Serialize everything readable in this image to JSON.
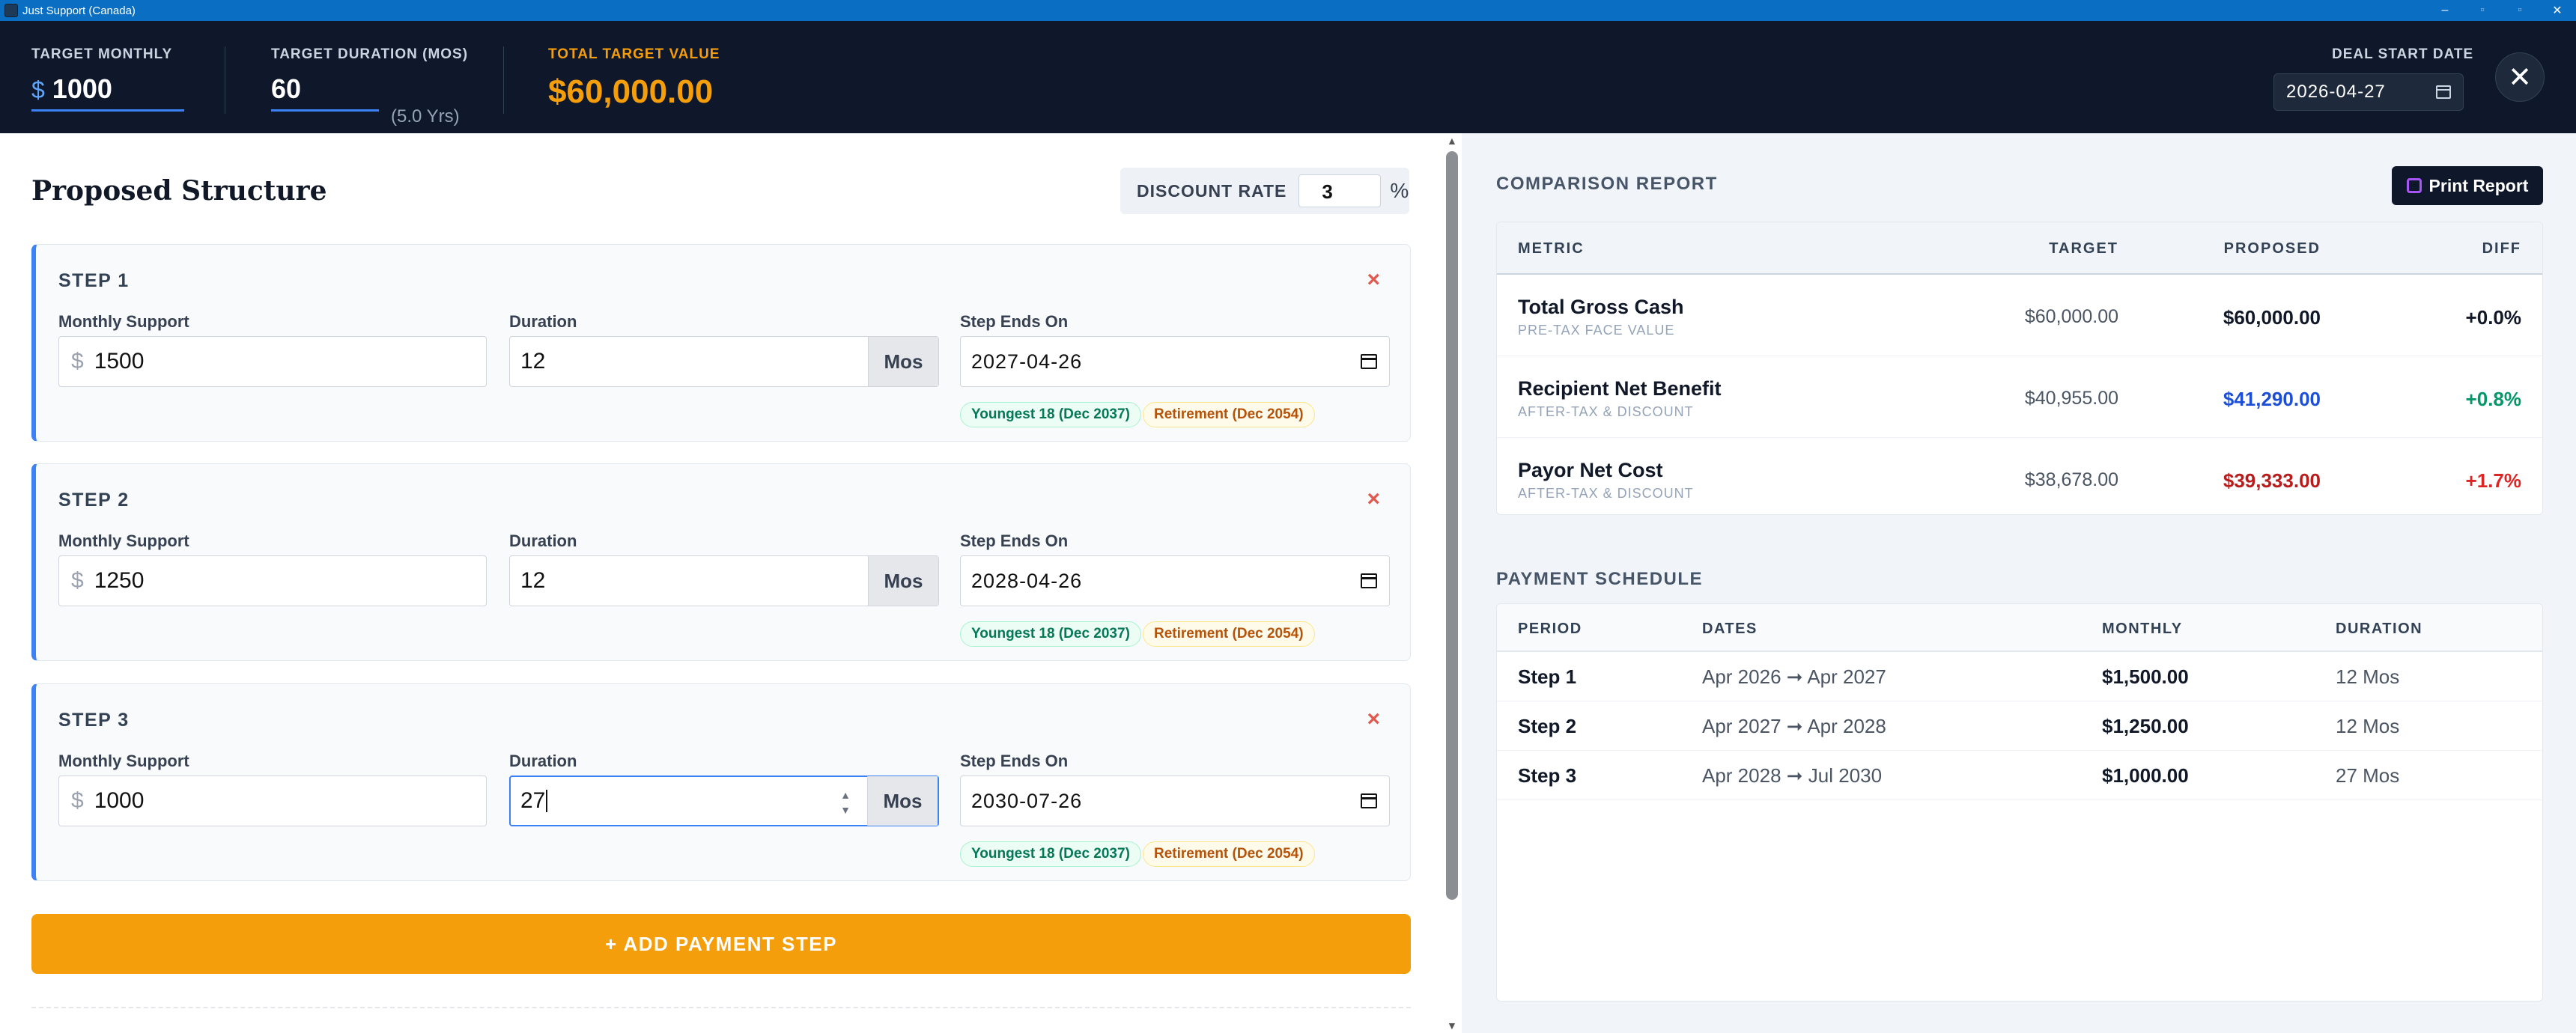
{
  "window": {
    "title": "Just Support (Canada)"
  },
  "header": {
    "target_monthly_label": "TARGET MONTHLY",
    "currency_symbol": "$",
    "target_monthly_value": "1000",
    "target_duration_label": "TARGET DURATION (MOS)",
    "target_duration_value": "60",
    "target_duration_years": "(5.0 Yrs)",
    "total_target_label": "TOTAL TARGET VALUE",
    "total_target_value": "$60,000.00",
    "deal_start_label": "DEAL START DATE",
    "deal_start_value": "2026-04-27"
  },
  "structure": {
    "title": "Proposed Structure",
    "discount_label": "DISCOUNT RATE",
    "discount_value": "3",
    "discount_unit": "%",
    "monthly_label": "Monthly Support",
    "duration_label": "Duration",
    "ends_label": "Step Ends On",
    "mos_label": "Mos",
    "remove_symbol": "×",
    "steps": [
      {
        "name": "STEP 1",
        "monthly": "1500",
        "duration": "12",
        "ends": "2027-04-26",
        "badge1": "Youngest 18 (Dec 2037)",
        "badge2": "Retirement (Dec 2054)"
      },
      {
        "name": "STEP 2",
        "monthly": "1250",
        "duration": "12",
        "ends": "2028-04-26",
        "badge1": "Youngest 18 (Dec 2037)",
        "badge2": "Retirement (Dec 2054)"
      },
      {
        "name": "STEP 3",
        "monthly": "1000",
        "duration": "27",
        "ends": "2030-07-26",
        "badge1": "Youngest 18 (Dec 2037)",
        "badge2": "Retirement (Dec 2054)"
      }
    ],
    "add_button": "+ ADD PAYMENT STEP"
  },
  "report": {
    "title": "COMPARISON REPORT",
    "print_label": "Print Report",
    "columns": [
      "METRIC",
      "TARGET",
      "PROPOSED",
      "DIFF"
    ],
    "rows": [
      {
        "metric": "Total Gross Cash",
        "sub": "PRE-TAX FACE VALUE",
        "target": "$60,000.00",
        "proposed": "$60,000.00",
        "diff": "+0.0%",
        "proposed_color": "#111827",
        "diff_color": "#111827"
      },
      {
        "metric": "Recipient Net Benefit",
        "sub": "AFTER-TAX & DISCOUNT",
        "target": "$40,955.00",
        "proposed": "$41,290.00",
        "diff": "+0.8%",
        "proposed_color": "#1d4ed8",
        "diff_color": "#059669"
      },
      {
        "metric": "Payor Net Cost",
        "sub": "AFTER-TAX & DISCOUNT",
        "target": "$38,678.00",
        "proposed": "$39,333.00",
        "diff": "+1.7%",
        "proposed_color": "#b91c1c",
        "diff_color": "#dc2626"
      }
    ]
  },
  "schedule": {
    "title": "PAYMENT SCHEDULE",
    "columns": [
      "PERIOD",
      "DATES",
      "MONTHLY",
      "DURATION"
    ],
    "rows": [
      {
        "period": "Step 1",
        "dates": "Apr 2026 ➞ Apr 2027",
        "monthly": "$1,500.00",
        "duration": "12 Mos"
      },
      {
        "period": "Step 2",
        "dates": "Apr 2027 ➞ Apr 2028",
        "monthly": "$1,250.00",
        "duration": "12 Mos"
      },
      {
        "period": "Step 3",
        "dates": "Apr 2028 ➞ Jul 2030",
        "monthly": "$1,000.00",
        "duration": "27 Mos"
      }
    ]
  }
}
